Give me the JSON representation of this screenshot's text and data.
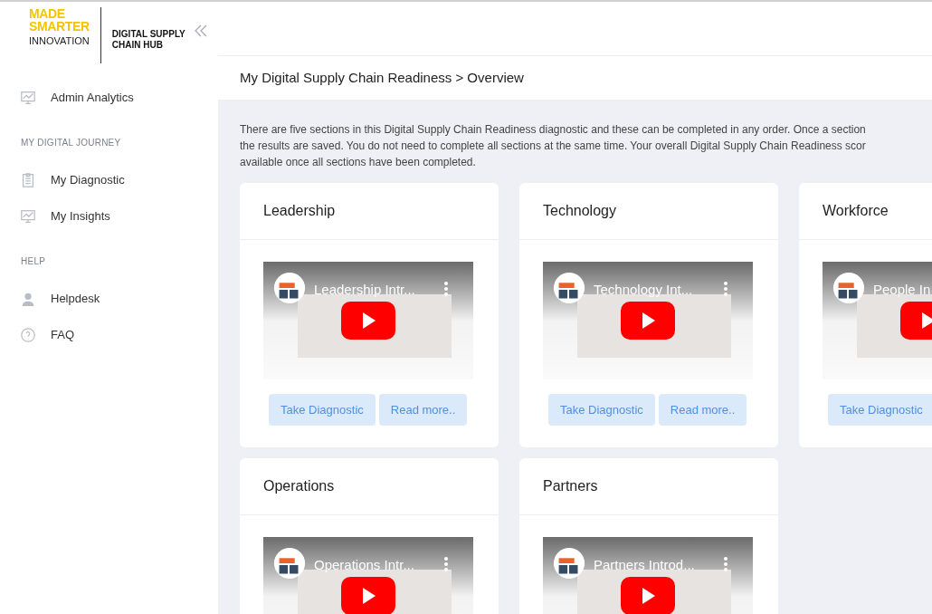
{
  "logo": {
    "brand_top": "MADE",
    "brand_middle": "SMARTER",
    "brand_bottom": "INNOVATION",
    "product": "DIGITAL SUPPLY CHAIN HUB"
  },
  "sidebar": {
    "items": [
      {
        "kind": "link",
        "label": "Admin Analytics"
      },
      {
        "kind": "heading",
        "label": "MY DIGITAL JOURNEY"
      },
      {
        "kind": "link",
        "label": "My Diagnostic"
      },
      {
        "kind": "link",
        "label": "My Insights"
      },
      {
        "kind": "heading",
        "label": "HELP"
      },
      {
        "kind": "link",
        "label": "Helpdesk"
      },
      {
        "kind": "link",
        "label": "FAQ"
      }
    ]
  },
  "breadcrumb": "My Digital Supply Chain Readiness > Overview",
  "intro_lines": [
    "There are five sections in this Digital Supply Chain Readiness diagnostic and these can be completed in any order. Once a section",
    "the results are saved. You do not need to complete all sections at the same time. Your overall Digital Supply Chain Readiness scor",
    "available once all sections have been completed."
  ],
  "sections": [
    {
      "title": "Leadership",
      "video_title": "Leadership Intr...",
      "buttons": [
        "Take Diagnostic",
        "Read more.."
      ]
    },
    {
      "title": "Technology",
      "video_title": "Technology Int...",
      "buttons": [
        "Take Diagnostic",
        "Read more.."
      ]
    },
    {
      "title": "Workforce",
      "video_title": "People In",
      "buttons": [
        "Take Diagnostic"
      ]
    },
    {
      "title": "Operations",
      "video_title": "Operations Intr..."
    },
    {
      "title": "Partners",
      "video_title": "Partners Introd..."
    }
  ]
}
